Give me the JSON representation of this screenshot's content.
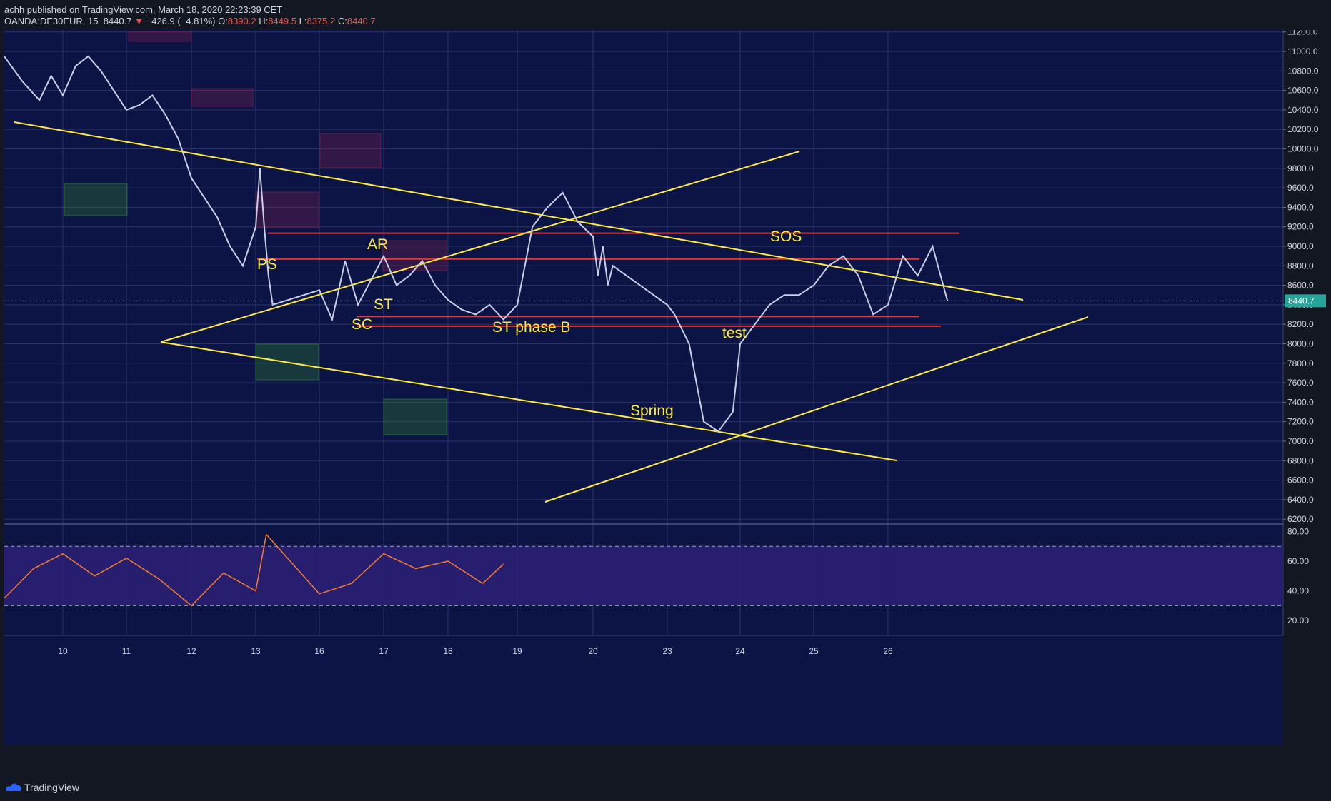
{
  "header": {
    "line1": "achh published on TradingView.com, March 18, 2020 22:23:39 CET",
    "symbol": "OANDA:DE30EUR, 15",
    "last": "8440.7",
    "change_arrow": "▼",
    "change": "−426.9 (−4.81%)",
    "o_label": "O:",
    "o_value": "8390.2",
    "h_label": "H:",
    "h_value": "8449.5",
    "l_label": "L:",
    "l_value": "8375.2",
    "c_label": "C:",
    "c_value": "8440.7"
  },
  "footer": {
    "brand": "TradingView",
    "logo_icon": "tradingview-logo-icon"
  },
  "colors": {
    "background": "#0c1445",
    "grid": "#2a3368",
    "price_line": "#c9cde6",
    "trendline": "#ffeb3b",
    "support_resistance": "#e53935",
    "rsi": "#f57c2e",
    "rsi_band": "#2a1f73",
    "last_price_badge": "#26a69a"
  },
  "chart_data": [
    {
      "type": "line",
      "title": "OANDA:DE30EUR, 15",
      "xlabel": "",
      "ylabel": "",
      "x_ticks": [
        "10",
        "11",
        "12",
        "13",
        "16",
        "17",
        "18",
        "19",
        "20",
        "23",
        "24",
        "25",
        "26"
      ],
      "y_ticks": [
        "11200.0",
        "11000.0",
        "10800.0",
        "10600.0",
        "10400.0",
        "10200.0",
        "10000.0",
        "9800.0",
        "9600.0",
        "9400.0",
        "9200.0",
        "9000.0",
        "8800.0",
        "8600.0",
        "8400.0",
        "8200.0",
        "8000.0",
        "7800.0",
        "7600.0",
        "7400.0",
        "7200.0",
        "7000.0",
        "6800.0",
        "6600.0",
        "6400.0",
        "6200.0"
      ],
      "ylim": [
        6150,
        11220
      ],
      "grid": true,
      "last_price_label": "8440.7",
      "series": [
        {
          "x": [
            "9",
            "9.3",
            "9.6",
            "9.8",
            "10",
            "10.2",
            "10.4",
            "10.6",
            "10.8",
            "11",
            "11.2",
            "11.4",
            "11.6",
            "11.8",
            "12",
            "12.2",
            "12.4",
            "12.6",
            "12.8",
            "13",
            "13.2",
            "13.4",
            "13.6",
            "13.8",
            "16",
            "16.2",
            "16.4",
            "16.6",
            "16.8",
            "17",
            "17.2",
            "17.4",
            "17.6",
            "17.8",
            "18",
            "18.2",
            "18.4",
            "18.6",
            "18.8",
            "19",
            "19.2",
            "19.4",
            "19.6",
            "19.8",
            "20",
            "20.2",
            "20.4",
            "20.6",
            "20.8",
            "23",
            "23.1",
            "23.3",
            "23.5",
            "23.7",
            "23.9",
            "24",
            "24.2",
            "24.4",
            "24.6",
            "24.8",
            "25",
            "25.2",
            "25.4",
            "25.6",
            "25.8",
            "26",
            "26.2",
            "26.4",
            "26.6",
            "26.8"
          ],
          "values": [
            10950,
            10700,
            10500,
            10750,
            10550,
            10850,
            10950,
            10800,
            10600,
            10400,
            10450,
            10550,
            10350,
            10100,
            9700,
            9500,
            9300,
            9000,
            8800,
            9200,
            9800,
            9200,
            8700,
            8400,
            8550,
            8250,
            8850,
            8400,
            8650,
            8900,
            8600,
            8700,
            8850,
            8600,
            8450,
            8350,
            8300,
            8400,
            8250,
            8400,
            9200,
            9400,
            9550,
            9250,
            9100,
            8700,
            9000,
            8600,
            8800,
            8400,
            8300,
            8000,
            7200,
            7100,
            7300,
            8000,
            8200,
            8400,
            8500,
            8500,
            8600,
            8800,
            8900,
            8700,
            8300,
            8400,
            8900,
            8700,
            9000,
            8440
          ],
          "x_positions_note": "trading-day index"
        }
      ],
      "annotations": [
        "PS",
        "SC",
        "AR",
        "ST",
        "ST phase B",
        "Spring",
        "test",
        "SOS"
      ]
    },
    {
      "type": "line",
      "title": "",
      "y_ticks": [
        "80.00",
        "60.00",
        "40.00",
        "20.00"
      ],
      "ylim": [
        10,
        85
      ],
      "overbought": 70,
      "oversold": 30,
      "series": [
        {
          "x": [
            "9",
            "9.5",
            "10",
            "10.5",
            "11",
            "11.5",
            "12",
            "12.5",
            "13",
            "13.5",
            "16",
            "16.5",
            "17",
            "17.5",
            "18",
            "18.5",
            "18.8"
          ],
          "values": [
            35,
            55,
            65,
            50,
            62,
            48,
            30,
            52,
            40,
            78,
            38,
            45,
            65,
            55,
            60,
            45,
            58
          ]
        }
      ]
    }
  ]
}
